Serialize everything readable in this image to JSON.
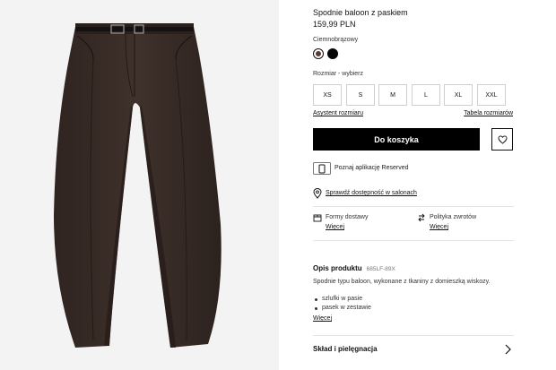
{
  "product": {
    "title": "Spodnie baloon z paskiem",
    "price": "159,99 PLN",
    "color_label": "Ciemnobrązowy",
    "colors": [
      {
        "name": "Ciemnobrązowy",
        "hex": "#5b3a34",
        "selected": true
      },
      {
        "name": "black",
        "hex": "#050505",
        "selected": false
      }
    ]
  },
  "size": {
    "label": "Rozmiar -  wybierz",
    "options": [
      "XS",
      "S",
      "M",
      "L",
      "XL",
      "XXL"
    ],
    "assistant_link": "Asystent rozmiaru",
    "table_link": "Tabela rozmiarów"
  },
  "actions": {
    "add_to_cart": "Do koszyka",
    "favorite_icon": "heart-icon"
  },
  "app_promo": {
    "text": "Poznaj aplikację Reserved",
    "icon": "phone-icon"
  },
  "store": {
    "link": "Sprawdź dostępność w salonach",
    "icon": "location-pin-icon"
  },
  "shipping": {
    "delivery_label": "Formy dostawy",
    "delivery_more": "Więcej",
    "delivery_icon": "box-icon",
    "returns_label": "Polityka zwrotów",
    "returns_more": "Więcej",
    "returns_icon": "return-arrows-icon"
  },
  "description": {
    "heading": "Opis produktu",
    "code": "685LF-89X",
    "text": "Spodnie typu baloon, wykonane z tkaniny z domieszką wiskozy.",
    "bullets": [
      "szlufki w pasie",
      "pasek w zestawie"
    ],
    "more": "Więcej"
  },
  "care": {
    "heading": "Skład i pielęgnacja",
    "icon": "chevron-right-icon"
  },
  "colors": {
    "accent": "#000000",
    "background": "#ffffff",
    "image_background": "#f3f3f3",
    "garment": "#3a2d28"
  }
}
